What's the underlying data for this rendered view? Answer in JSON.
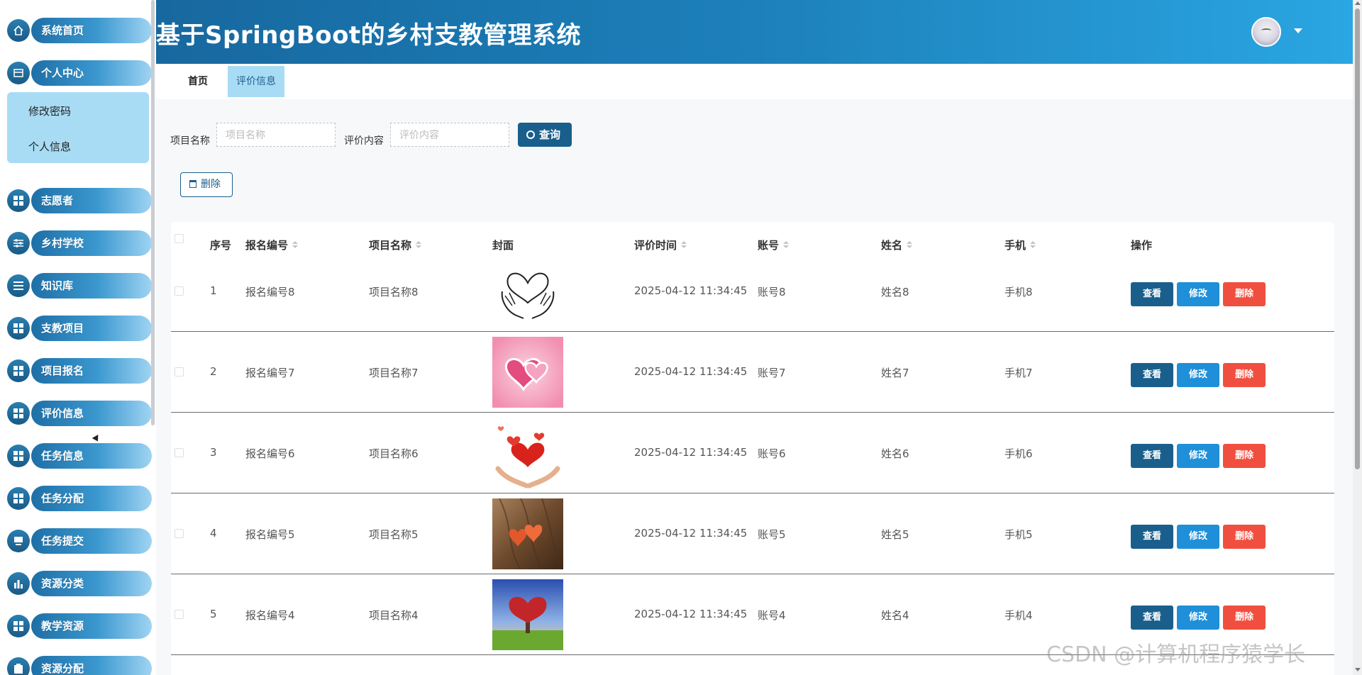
{
  "sidebar": {
    "items": [
      {
        "label": "系统首页"
      },
      {
        "label": "个人中心"
      },
      {
        "label": "志愿者"
      },
      {
        "label": "乡村学校"
      },
      {
        "label": "知识库"
      },
      {
        "label": "支教项目"
      },
      {
        "label": "项目报名"
      },
      {
        "label": "评价信息"
      },
      {
        "label": "任务信息"
      },
      {
        "label": "任务分配"
      },
      {
        "label": "任务提交"
      },
      {
        "label": "资源分类"
      },
      {
        "label": "教学资源"
      },
      {
        "label": "资源分配"
      }
    ],
    "sub_items": [
      {
        "label": "修改密码"
      },
      {
        "label": "个人信息"
      }
    ]
  },
  "header": {
    "title": "基于SpringBoot的乡村支教管理系统"
  },
  "tabs": [
    {
      "label": "首页"
    },
    {
      "label": "评价信息"
    }
  ],
  "search": {
    "project_label": "项目名称",
    "project_placeholder": "项目名称",
    "content_label": "评价内容",
    "content_placeholder": "评价内容",
    "query_label": "查询"
  },
  "toolbar": {
    "delete_label": "删除"
  },
  "table": {
    "headers": [
      "序号",
      "报名编号",
      "项目名称",
      "封面",
      "评价时间",
      "账号",
      "姓名",
      "手机",
      "操作"
    ],
    "rows": [
      {
        "index": "1",
        "signup_no": "报名编号8",
        "project": "项目名称8",
        "time": "2025-04-12 11:34:45",
        "account": "账号8",
        "name": "姓名8",
        "phone": "手机8"
      },
      {
        "index": "2",
        "signup_no": "报名编号7",
        "project": "项目名称7",
        "time": "2025-04-12 11:34:45",
        "account": "账号7",
        "name": "姓名7",
        "phone": "手机7"
      },
      {
        "index": "3",
        "signup_no": "报名编号6",
        "project": "项目名称6",
        "time": "2025-04-12 11:34:45",
        "account": "账号6",
        "name": "姓名6",
        "phone": "手机6"
      },
      {
        "index": "4",
        "signup_no": "报名编号5",
        "project": "项目名称5",
        "time": "2025-04-12 11:34:45",
        "account": "账号5",
        "name": "姓名5",
        "phone": "手机5"
      },
      {
        "index": "5",
        "signup_no": "报名编号4",
        "project": "项目名称4",
        "time": "2025-04-12 11:34:45",
        "account": "账号4",
        "name": "姓名4",
        "phone": "手机4"
      }
    ],
    "actions": {
      "view": "查看",
      "edit": "修改",
      "delete": "删除"
    }
  },
  "watermark": "CSDN @计算机程序猿学长",
  "colors": {
    "primary": "#1a5f8c",
    "edit": "#1e8fd8",
    "danger": "#f04f3f",
    "active_tab": "#a8dcf5"
  }
}
